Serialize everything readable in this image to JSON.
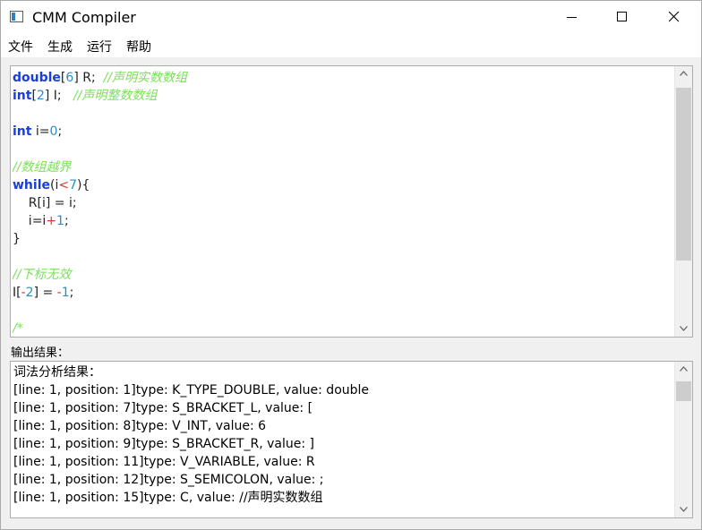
{
  "window": {
    "title": "CMM Compiler"
  },
  "menu": [
    "文件",
    "生成",
    "运行",
    "帮助"
  ],
  "editor": {
    "lines": [
      [
        {
          "t": "double",
          "c": "kw"
        },
        {
          "t": "[",
          "c": ""
        },
        {
          "t": "6",
          "c": "num"
        },
        {
          "t": "] R;  ",
          "c": ""
        },
        {
          "t": "//声明实数数组",
          "c": "cmt"
        }
      ],
      [
        {
          "t": "int",
          "c": "kw"
        },
        {
          "t": "[",
          "c": ""
        },
        {
          "t": "2",
          "c": "num"
        },
        {
          "t": "] I;   ",
          "c": ""
        },
        {
          "t": "//声明整数数组",
          "c": "cmt"
        }
      ],
      [],
      [
        {
          "t": "int",
          "c": "kw"
        },
        {
          "t": " i=",
          "c": ""
        },
        {
          "t": "0",
          "c": "num"
        },
        {
          "t": ";",
          "c": ""
        }
      ],
      [],
      [
        {
          "t": "//数组越界",
          "c": "cmt"
        }
      ],
      [
        {
          "t": "while",
          "c": "kw"
        },
        {
          "t": "(i",
          "c": ""
        },
        {
          "t": "<",
          "c": "op"
        },
        {
          "t": "7",
          "c": "num"
        },
        {
          "t": "){",
          "c": ""
        }
      ],
      [
        {
          "t": "    R[i] = i;",
          "c": ""
        }
      ],
      [
        {
          "t": "    i=i",
          "c": ""
        },
        {
          "t": "+",
          "c": "op"
        },
        {
          "t": "1",
          "c": "num"
        },
        {
          "t": ";",
          "c": ""
        }
      ],
      [
        {
          "t": "}",
          "c": ""
        }
      ],
      [],
      [
        {
          "t": "//下标无效",
          "c": "cmt"
        }
      ],
      [
        {
          "t": "I[",
          "c": ""
        },
        {
          "t": "-",
          "c": "op"
        },
        {
          "t": "2",
          "c": "num"
        },
        {
          "t": "] = ",
          "c": ""
        },
        {
          "t": "-",
          "c": "op"
        },
        {
          "t": "1",
          "c": "num"
        },
        {
          "t": ";",
          "c": ""
        }
      ],
      [],
      [
        {
          "t": "/*",
          "c": "cmt"
        }
      ]
    ]
  },
  "output": {
    "label": "输出结果：",
    "lines": [
      "词法分析结果：",
      "[line: 1, position: 1]type: K_TYPE_DOUBLE, value: double",
      "[line: 1, position: 7]type: S_BRACKET_L, value: [",
      "[line: 1, position: 8]type: V_INT, value: 6",
      "[line: 1, position: 9]type: S_BRACKET_R, value: ]",
      "[line: 1, position: 11]type: V_VARIABLE, value: R",
      "[line: 1, position: 12]type: S_SEMICOLON, value: ;",
      "[line: 1, position: 15]type: C, value: //声明实数数组"
    ]
  },
  "colors": {
    "keyword": "#1a3fd8",
    "number": "#2a8dc5",
    "comment": "#7ce05a",
    "operator": "#e0362a"
  },
  "icons": {
    "app": "window-app-icon",
    "minimize": "minimize-icon",
    "maximize": "maximize-icon",
    "close": "close-icon"
  }
}
